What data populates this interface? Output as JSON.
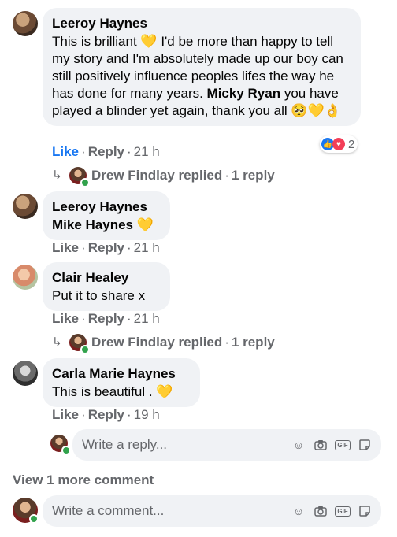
{
  "comments": [
    {
      "author": "Leeroy Haynes",
      "text_part1": "This is brilliant ",
      "text_part2": " I'd be more than happy to tell my story and I'm absolutely made up our boy can still positively influence peoples lifes the way he has done for many years. ",
      "mention": "Micky Ryan",
      "text_part3": " you have played a blinder yet again, thank you all ",
      "emoji_end": "🥺💛👌",
      "like": "Like",
      "reply": "Reply",
      "time": "21 h",
      "reaction_count": "2",
      "replied_by": "Drew Findlay replied",
      "reply_count": "1 reply"
    },
    {
      "author": "Leeroy Haynes",
      "text": "Mike Haynes ",
      "like": "Like",
      "reply": "Reply",
      "time": "21 h"
    },
    {
      "author": "Clair Healey",
      "text": "Put it to share x",
      "like": "Like",
      "reply": "Reply",
      "time": "21 h",
      "replied_by": "Drew Findlay replied",
      "reply_count": "1 reply"
    },
    {
      "author": "Carla Marie Haynes",
      "text": "This is beautiful . ",
      "like": "Like",
      "reply": "Reply",
      "time": "19 h"
    }
  ],
  "reply_box": {
    "placeholder": "Write a reply..."
  },
  "view_more": "View 1 more comment",
  "comment_box": {
    "placeholder": "Write a comment..."
  },
  "icons": [
    "smile-icon",
    "camera-icon",
    "gif-icon",
    "sticker-icon"
  ],
  "colors": {
    "like_blue": "#1877f2",
    "bubble": "#f0f2f5",
    "muted": "#65676b",
    "online": "#31a24c"
  }
}
